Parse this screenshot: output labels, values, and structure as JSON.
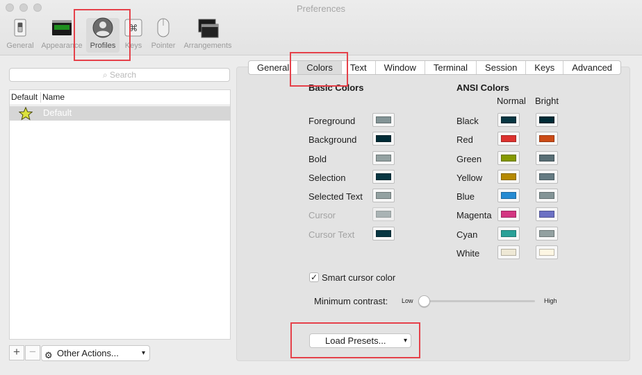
{
  "window": {
    "title": "Preferences"
  },
  "toolbar": {
    "items": [
      {
        "label": "General",
        "icon": "switch-icon"
      },
      {
        "label": "Appearance",
        "icon": "monitor-icon"
      },
      {
        "label": "Profiles",
        "icon": "person-icon",
        "active": true
      },
      {
        "label": "Keys",
        "icon": "command-key-icon"
      },
      {
        "label": "Pointer",
        "icon": "mouse-icon"
      },
      {
        "label": "Arrangements",
        "icon": "windows-icon"
      }
    ]
  },
  "profiles": {
    "search_placeholder": "Search",
    "col_default": "Default",
    "col_name": "Name",
    "rows": [
      {
        "name": "Default",
        "is_default": true
      }
    ],
    "add_label": "+",
    "remove_label": "−",
    "other_actions_label": "Other Actions..."
  },
  "tabs": {
    "items": [
      "General",
      "Colors",
      "Text",
      "Window",
      "Terminal",
      "Session",
      "Keys",
      "Advanced"
    ],
    "active": "Colors"
  },
  "colors": {
    "basic_heading": "Basic Colors",
    "basic": [
      {
        "label": "Foreground",
        "color": "#839496"
      },
      {
        "label": "Background",
        "color": "#002b36"
      },
      {
        "label": "Bold",
        "color": "#93a1a1"
      },
      {
        "label": "Selection",
        "color": "#073642"
      },
      {
        "label": "Selected Text",
        "color": "#93a1a1"
      },
      {
        "label": "Cursor",
        "color": "#839496",
        "disabled": true
      },
      {
        "label": "Cursor Text",
        "color": "#073642",
        "disabled": true
      }
    ],
    "ansi_heading": "ANSI Colors",
    "normal_label": "Normal",
    "bright_label": "Bright",
    "ansi": [
      {
        "label": "Black",
        "normal": "#073642",
        "bright": "#002b36"
      },
      {
        "label": "Red",
        "normal": "#dc322f",
        "bright": "#cb4b16"
      },
      {
        "label": "Green",
        "normal": "#859900",
        "bright": "#586e75"
      },
      {
        "label": "Yellow",
        "normal": "#b58900",
        "bright": "#657b83"
      },
      {
        "label": "Blue",
        "normal": "#268bd2",
        "bright": "#839496"
      },
      {
        "label": "Magenta",
        "normal": "#d33682",
        "bright": "#6c71c4"
      },
      {
        "label": "Cyan",
        "normal": "#2aa198",
        "bright": "#93a1a1"
      },
      {
        "label": "White",
        "normal": "#eee8d5",
        "bright": "#fdf6e3"
      }
    ],
    "smart_cursor_label": "Smart cursor color",
    "smart_cursor_checked": true,
    "min_contrast_label": "Minimum contrast:",
    "low_label": "Low",
    "high_label": "High",
    "min_contrast_value": 0,
    "load_presets_label": "Load Presets..."
  }
}
